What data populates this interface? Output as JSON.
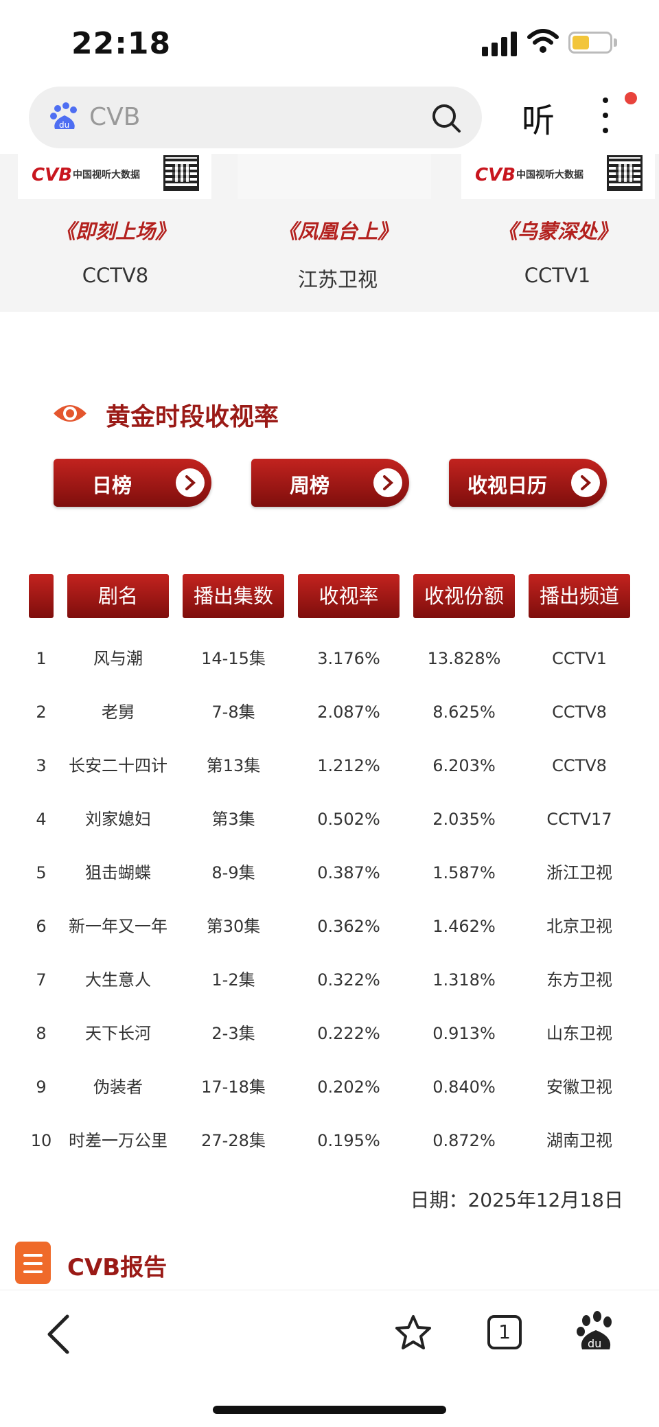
{
  "status_bar": {
    "time": "22:18"
  },
  "search": {
    "text": "CVB",
    "listen_label": "听"
  },
  "top_cards": {
    "logo_text": "CVB",
    "logo_sub": "中国视听大数据",
    "shows": [
      {
        "title": "《即刻上场》",
        "channel": "CCTV8"
      },
      {
        "title": "《凤凰台上》",
        "channel": "江苏卫视"
      },
      {
        "title": "《乌蒙深处》",
        "channel": "CCTV1"
      }
    ]
  },
  "section": {
    "title": "黄金时段收视率",
    "buttons": [
      "日榜",
      "周榜",
      "收视日历"
    ]
  },
  "table": {
    "headers": [
      "剧名",
      "播出集数",
      "收视率",
      "收视份额",
      "播出频道"
    ],
    "rows": [
      [
        "1",
        "风与潮",
        "14-15集",
        "3.176%",
        "13.828%",
        "CCTV1"
      ],
      [
        "2",
        "老舅",
        "7-8集",
        "2.087%",
        "8.625%",
        "CCTV8"
      ],
      [
        "3",
        "长安二十四计",
        "第13集",
        "1.212%",
        "6.203%",
        "CCTV8"
      ],
      [
        "4",
        "刘家媳妇",
        "第3集",
        "0.502%",
        "2.035%",
        "CCTV17"
      ],
      [
        "5",
        "狙击蝴蝶",
        "8-9集",
        "0.387%",
        "1.587%",
        "浙江卫视"
      ],
      [
        "6",
        "新一年又一年",
        "第30集",
        "0.362%",
        "1.462%",
        "北京卫视"
      ],
      [
        "7",
        "大生意人",
        "1-2集",
        "0.322%",
        "1.318%",
        "东方卫视"
      ],
      [
        "8",
        "天下长河",
        "2-3集",
        "0.222%",
        "0.913%",
        "山东卫视"
      ],
      [
        "9",
        "伪装者",
        "17-18集",
        "0.202%",
        "0.840%",
        "安徽卫视"
      ],
      [
        "10",
        "时差一万公里",
        "27-28集",
        "0.195%",
        "0.872%",
        "湖南卫视"
      ]
    ],
    "date": "日期：2025年12月18日"
  },
  "report": {
    "title": "CVB报告"
  },
  "bottom_nav": {
    "tab_count": "1"
  }
}
